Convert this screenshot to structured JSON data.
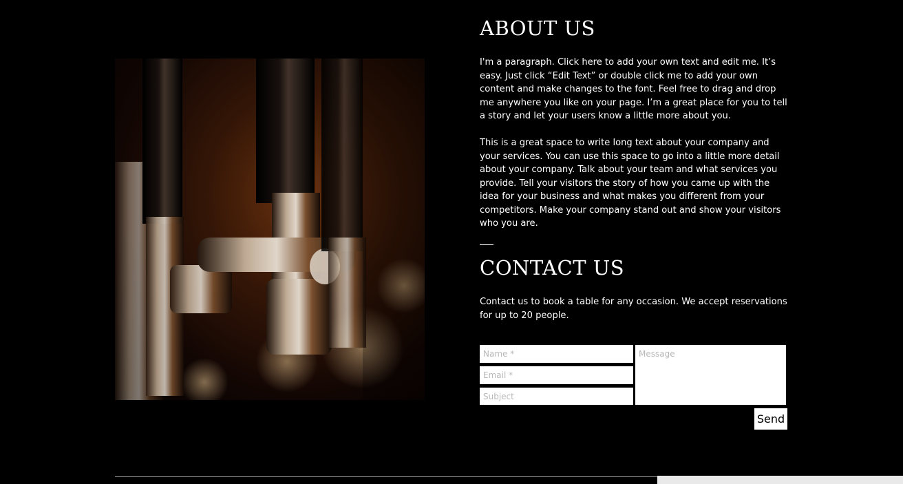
{
  "about": {
    "title": "ABOUT US",
    "paragraph_1": "I'm a paragraph. Click here to add your own text and edit me. It’s easy. Just click “Edit Text” or double click me to add your own content and make changes to the font. Feel free to drag and drop me anywhere you like on your page. I’m a great place for you to tell a story and let your users know a little more about you.",
    "paragraph_2": "This is a great space to write long text about your company and your services. You can use this space to go into a little more detail about your company. Talk about your team and what services you provide. Tell your visitors the story of how you came up with the idea for your business and what makes you different from your competitors. Make your company stand out and show your visitors who you are."
  },
  "contact": {
    "title": "CONTACT US",
    "description": "Contact us to book a table for any occasion. We accept reservations for up to 20 people."
  },
  "form": {
    "name_placeholder": "Name *",
    "email_placeholder": "Email *",
    "subject_placeholder": "Subject",
    "message_placeholder": "Message",
    "send_label": "Send"
  },
  "image": {
    "icon": "beer-taps-photo"
  },
  "colors": {
    "background": "#000000",
    "text": "#ffffff",
    "field_bg": "#ffffff",
    "placeholder": "#b8b8b8"
  }
}
